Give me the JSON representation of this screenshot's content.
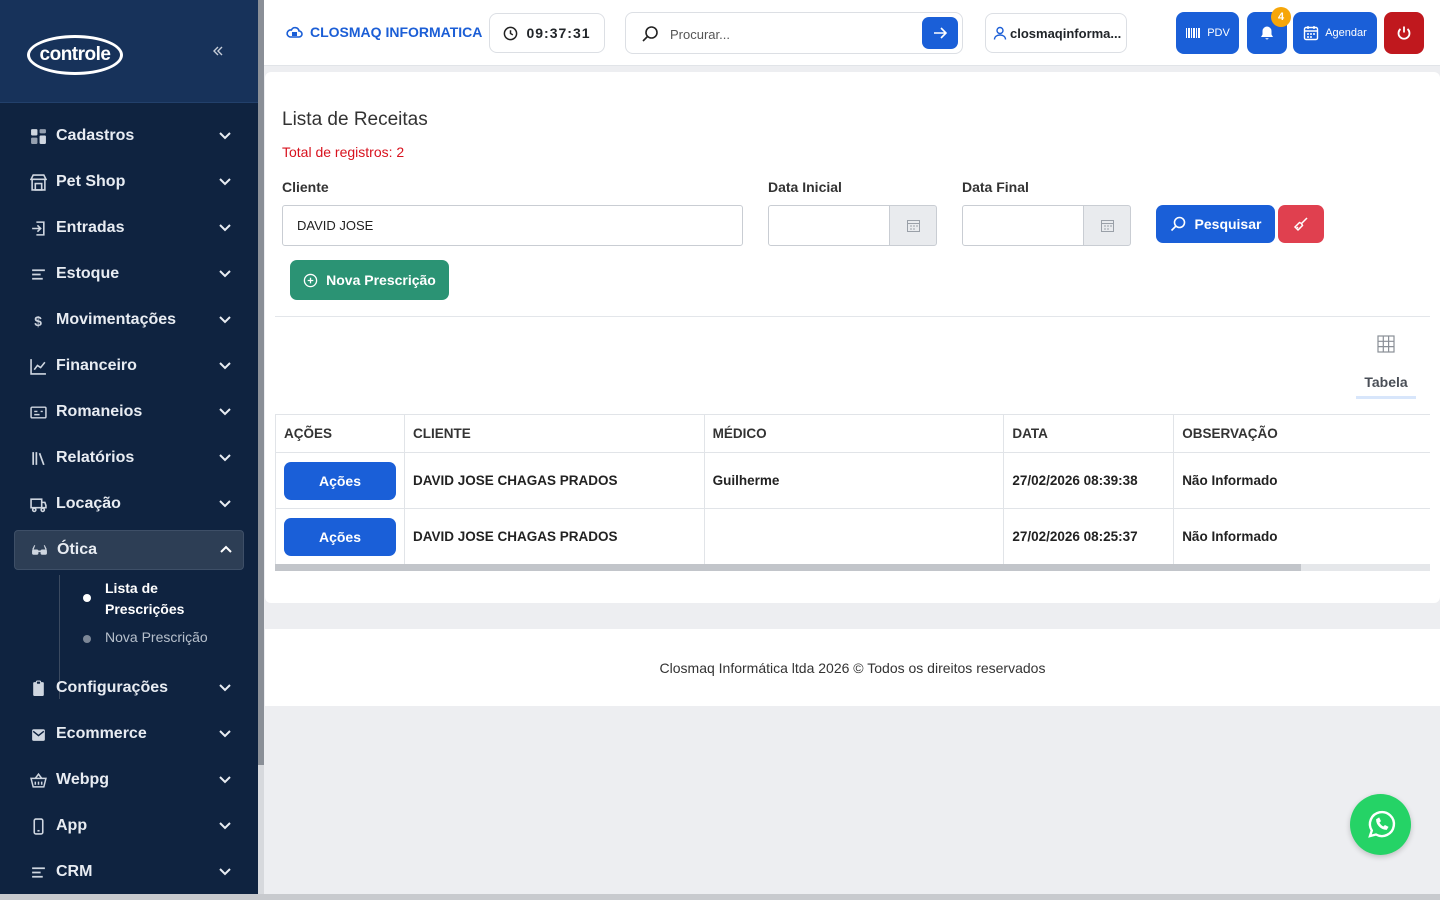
{
  "sidebar": {
    "logo_text": "controle",
    "items": [
      {
        "label": "Cadastros",
        "icon": "grid-icon"
      },
      {
        "label": "Pet Shop",
        "icon": "store-icon"
      },
      {
        "label": "Entradas",
        "icon": "login-icon"
      },
      {
        "label": "Estoque",
        "icon": "list-icon"
      },
      {
        "label": "Movimentações",
        "icon": "dollar-icon"
      },
      {
        "label": "Financeiro",
        "icon": "chart-icon"
      },
      {
        "label": "Romaneios",
        "icon": "id-card-icon"
      },
      {
        "label": "Relatórios",
        "icon": "books-icon"
      },
      {
        "label": "Locação",
        "icon": "truck-icon"
      },
      {
        "label": "Ótica",
        "icon": "glasses-icon"
      },
      {
        "label": "Configurações",
        "icon": "clipboard-icon"
      },
      {
        "label": "Ecommerce",
        "icon": "mail-icon"
      },
      {
        "label": "Webpg",
        "icon": "basket-icon"
      },
      {
        "label": "App",
        "icon": "phone-icon"
      },
      {
        "label": "CRM",
        "icon": "list-icon"
      }
    ],
    "submenu": {
      "current": "Lista de Prescrições",
      "other": "Nova Prescrição"
    }
  },
  "header": {
    "company": "CLOSMAQ INFORMATICA",
    "clock": "09:37:31",
    "search_placeholder": "Procurar...",
    "user": "closmaqinforma...",
    "pdv_label": "PDV",
    "notifications_count": "4",
    "agendar_label": "Agendar"
  },
  "page": {
    "title": "Lista de Receitas",
    "total": "Total de registros: 2",
    "filters": {
      "cliente_label": "Cliente",
      "cliente_value": "DAVID JOSE",
      "data_inicial_label": "Data Inicial",
      "data_final_label": "Data Final"
    },
    "search_button": "Pesquisar",
    "new_button": "Nova Prescrição",
    "view_label": "Tabela"
  },
  "table": {
    "headers": [
      "AÇÕES",
      "CLIENTE",
      "MÉDICO",
      "DATA",
      "OBSERVAÇÃO"
    ],
    "action_label": "Ações",
    "rows": [
      {
        "cliente": "DAVID JOSE CHAGAS PRADOS",
        "medico": "Guilherme",
        "data": "27/02/2026 08:39:38",
        "obs": "Não Informado"
      },
      {
        "cliente": "DAVID JOSE CHAGAS PRADOS",
        "medico": "",
        "data": "27/02/2026 08:25:37",
        "obs": "Não Informado"
      }
    ]
  },
  "footer": {
    "text": "Closmaq Informática ltda 2026 © Todos os direitos reservados"
  },
  "colors": {
    "sidebar_bg": "#0f2340",
    "primary": "#1a5fd8",
    "success": "#2b9374",
    "danger": "#e0404f",
    "total_red": "#d8121e",
    "whatsapp": "#25d366"
  }
}
